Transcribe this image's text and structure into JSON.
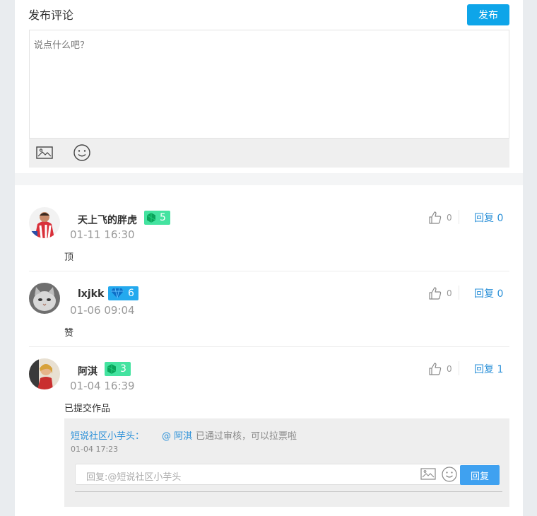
{
  "compose": {
    "title": "发布评论",
    "publish_label": "发布",
    "placeholder": "说点什么吧？",
    "tools": [
      "image-icon",
      "emoji-icon"
    ]
  },
  "comments": [
    {
      "username": "天上飞的胖虎",
      "badge_level": "5",
      "badge_type": "gem-green",
      "time": "01-11 16:30",
      "text": "顶",
      "likes": "0",
      "reply_label": "回复 0"
    },
    {
      "username": "lxjkk",
      "badge_level": "6",
      "badge_type": "diamond-blue",
      "time": "01-06 09:04",
      "text": "赞",
      "likes": "0",
      "reply_label": "回复 0"
    },
    {
      "username": "阿淇",
      "badge_level": "3",
      "badge_type": "gem-green",
      "time": "01-04 16:39",
      "text": "已提交作品",
      "likes": "0",
      "reply_label": "回复 1"
    }
  ],
  "subreply": {
    "author": "短说社区小芋头：",
    "mention": "@ 阿淇",
    "text": "已通过审核，可以拉票啦",
    "time": "01-04 17:23",
    "input_placeholder": "回复:@短说社区小芋头",
    "send_label": "回复"
  },
  "colors": {
    "accent": "#0ea5e9",
    "link": "#2a90d8",
    "badge_green": "#44e3a0",
    "badge_blue": "#24a9ee"
  }
}
